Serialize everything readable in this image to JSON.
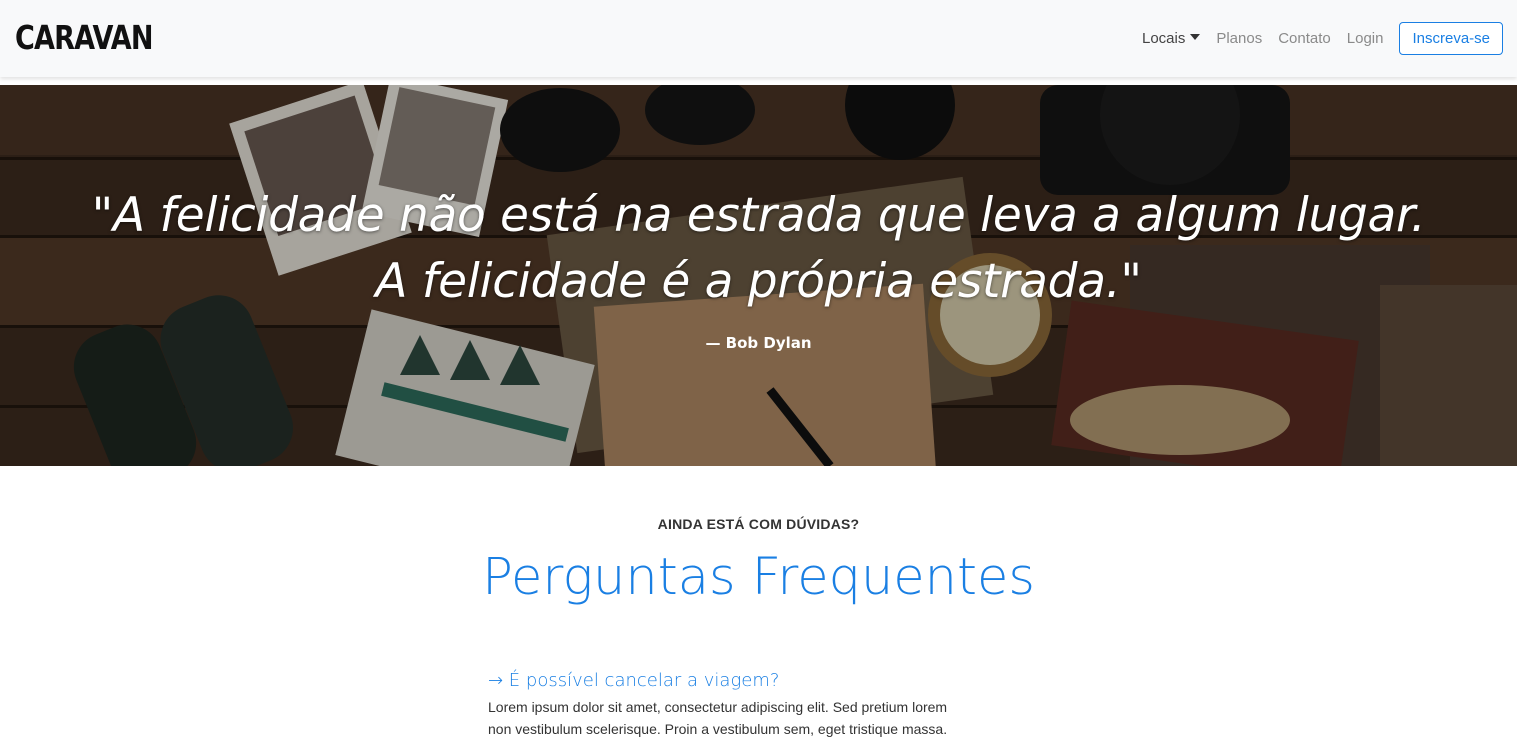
{
  "navbar": {
    "brand": "CARAVAN",
    "links": {
      "locais": "Locais",
      "planos": "Planos",
      "contato": "Contato",
      "login": "Login"
    },
    "cta": "Inscreva-se",
    "accent_color": "#1a7fe3"
  },
  "hero": {
    "quote_line1": "\"A felicidade não está na estrada que leva a algum lugar.",
    "quote_line2": "A felicidade é a própria estrada.\"",
    "author": "— Bob Dylan"
  },
  "faq": {
    "kicker": "AINDA ESTÁ COM DÚVIDAS?",
    "title": "Perguntas Frequentes",
    "items": [
      {
        "question": "→ É possível cancelar a viagem?",
        "answer_line1": "Lorem ipsum dolor sit amet, consectetur adipiscing elit. Sed pretium lorem",
        "answer_line2": "non vestibulum scelerisque. Proin a vestibulum sem, eget tristique massa."
      }
    ]
  }
}
